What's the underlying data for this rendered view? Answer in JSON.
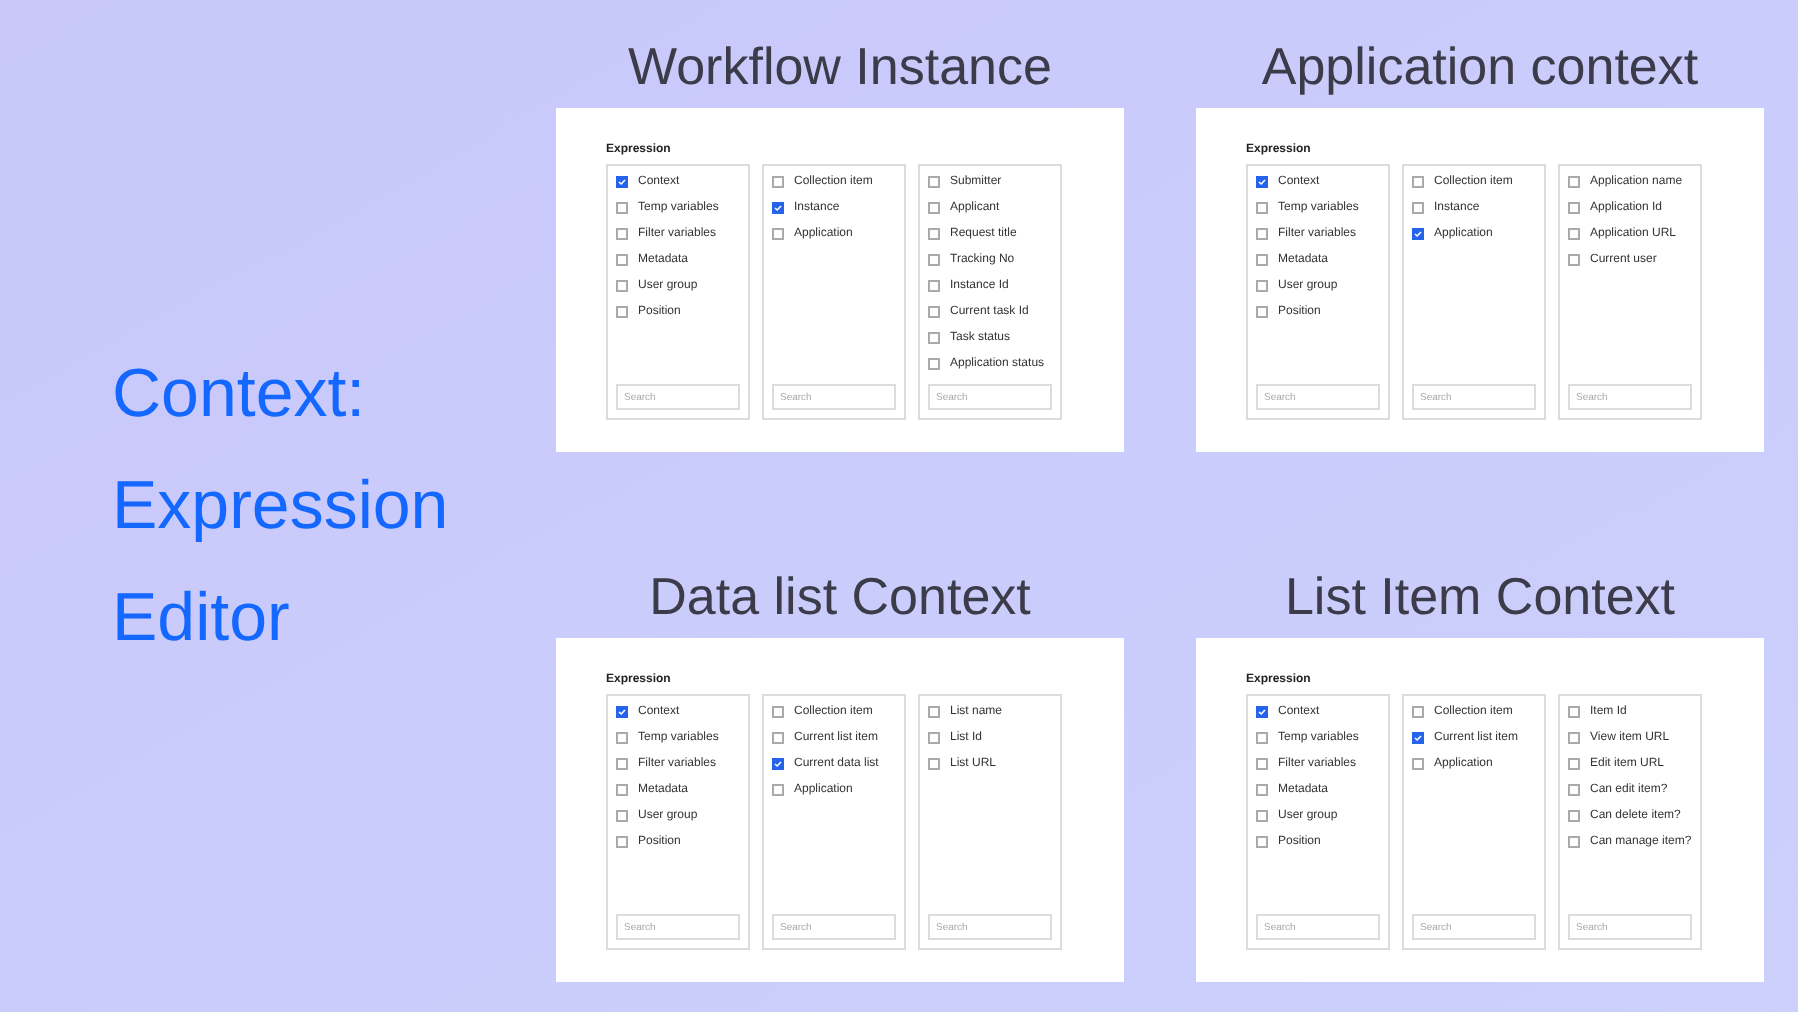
{
  "title": "Context: Expression Editor",
  "panels": [
    {
      "heading": "Workflow Instance",
      "label": "Expression",
      "columns": [
        {
          "items": [
            {
              "label": "Context",
              "checked": true
            },
            {
              "label": "Temp variables",
              "checked": false
            },
            {
              "label": "Filter variables",
              "checked": false
            },
            {
              "label": "Metadata",
              "checked": false
            },
            {
              "label": "User group",
              "checked": false
            },
            {
              "label": "Position",
              "checked": false
            }
          ],
          "placeholder": "Search"
        },
        {
          "items": [
            {
              "label": "Collection item",
              "checked": false
            },
            {
              "label": "Instance",
              "checked": true
            },
            {
              "label": "Application",
              "checked": false
            }
          ],
          "placeholder": "Search"
        },
        {
          "items": [
            {
              "label": "Submitter",
              "checked": false
            },
            {
              "label": "Applicant",
              "checked": false
            },
            {
              "label": "Request title",
              "checked": false
            },
            {
              "label": "Tracking No",
              "checked": false
            },
            {
              "label": "Instance Id",
              "checked": false
            },
            {
              "label": "Current task Id",
              "checked": false
            },
            {
              "label": "Task status",
              "checked": false
            },
            {
              "label": "Application status",
              "checked": false
            }
          ],
          "placeholder": "Search"
        }
      ]
    },
    {
      "heading": "Application context",
      "label": "Expression",
      "columns": [
        {
          "items": [
            {
              "label": "Context",
              "checked": true
            },
            {
              "label": "Temp variables",
              "checked": false
            },
            {
              "label": "Filter variables",
              "checked": false
            },
            {
              "label": "Metadata",
              "checked": false
            },
            {
              "label": "User group",
              "checked": false
            },
            {
              "label": "Position",
              "checked": false
            }
          ],
          "placeholder": "Search"
        },
        {
          "items": [
            {
              "label": "Collection item",
              "checked": false
            },
            {
              "label": "Instance",
              "checked": false
            },
            {
              "label": "Application",
              "checked": true
            }
          ],
          "placeholder": "Search"
        },
        {
          "items": [
            {
              "label": "Application name",
              "checked": false
            },
            {
              "label": "Application Id",
              "checked": false
            },
            {
              "label": "Application URL",
              "checked": false
            },
            {
              "label": "Current user",
              "checked": false
            }
          ],
          "placeholder": "Search"
        }
      ]
    },
    {
      "heading": "Data list Context",
      "label": "Expression",
      "columns": [
        {
          "items": [
            {
              "label": "Context",
              "checked": true
            },
            {
              "label": "Temp variables",
              "checked": false
            },
            {
              "label": "Filter variables",
              "checked": false
            },
            {
              "label": "Metadata",
              "checked": false
            },
            {
              "label": "User group",
              "checked": false
            },
            {
              "label": "Position",
              "checked": false
            }
          ],
          "placeholder": "Search"
        },
        {
          "items": [
            {
              "label": "Collection item",
              "checked": false
            },
            {
              "label": "Current list item",
              "checked": false
            },
            {
              "label": "Current data list",
              "checked": true
            },
            {
              "label": "Application",
              "checked": false
            }
          ],
          "placeholder": "Search"
        },
        {
          "items": [
            {
              "label": "List name",
              "checked": false
            },
            {
              "label": "List Id",
              "checked": false
            },
            {
              "label": "List URL",
              "checked": false
            }
          ],
          "placeholder": "Search"
        }
      ]
    },
    {
      "heading": "List Item Context",
      "label": "Expression",
      "columns": [
        {
          "items": [
            {
              "label": "Context",
              "checked": true
            },
            {
              "label": "Temp variables",
              "checked": false
            },
            {
              "label": "Filter variables",
              "checked": false
            },
            {
              "label": "Metadata",
              "checked": false
            },
            {
              "label": "User group",
              "checked": false
            },
            {
              "label": "Position",
              "checked": false
            }
          ],
          "placeholder": "Search"
        },
        {
          "items": [
            {
              "label": "Collection item",
              "checked": false
            },
            {
              "label": "Current list item",
              "checked": true
            },
            {
              "label": "Application",
              "checked": false
            }
          ],
          "placeholder": "Search"
        },
        {
          "items": [
            {
              "label": "Item Id",
              "checked": false
            },
            {
              "label": "View item URL",
              "checked": false
            },
            {
              "label": "Edit item URL",
              "checked": false
            },
            {
              "label": "Can edit item?",
              "checked": false
            },
            {
              "label": "Can delete item?",
              "checked": false
            },
            {
              "label": "Can manage item?",
              "checked": false
            }
          ],
          "placeholder": "Search"
        }
      ]
    }
  ]
}
